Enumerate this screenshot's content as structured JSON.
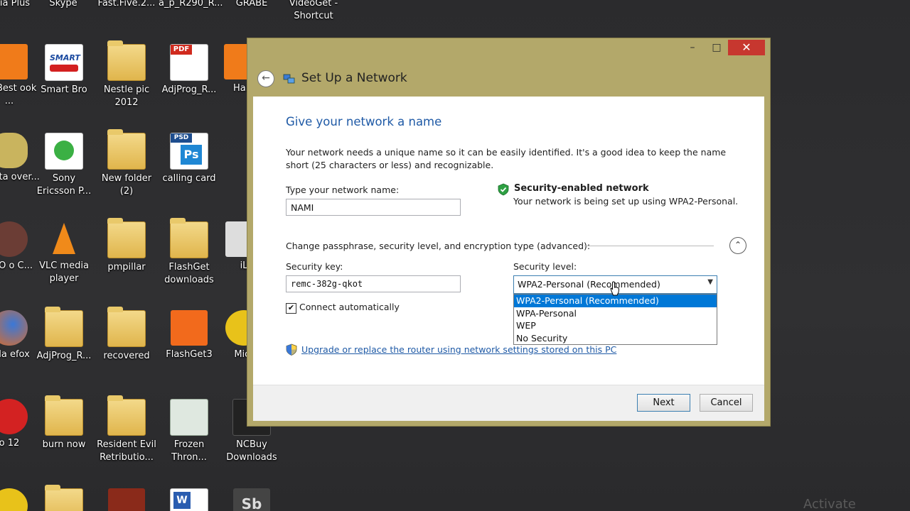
{
  "desktop": {
    "icons": [
      {
        "label": "ia Plus"
      },
      {
        "label": "Skype"
      },
      {
        "label": "Fast.Five.2..."
      },
      {
        "label": "a_p_R290_R..."
      },
      {
        "label": "GRABE"
      },
      {
        "label": "VideoGet - Shortcut"
      },
      {
        "label": "he Best ook ..."
      },
      {
        "label": "Smart Bro"
      },
      {
        "label": "Nestle pic 2012"
      },
      {
        "label": "AdjProg_R..."
      },
      {
        "label": "Han"
      },
      {
        "label": "e data over..."
      },
      {
        "label": "Sony Ericsson P..."
      },
      {
        "label": "New folder (2)"
      },
      {
        "label": "calling card"
      },
      {
        "label": "TOO o C..."
      },
      {
        "label": "VLC media player"
      },
      {
        "label": "pmpillar"
      },
      {
        "label": "FlashGet downloads"
      },
      {
        "label": "iL"
      },
      {
        "label": "zilla efox"
      },
      {
        "label": "AdjProg_R..."
      },
      {
        "label": "recovered"
      },
      {
        "label": "FlashGet3"
      },
      {
        "label": "Micr"
      },
      {
        "label": "o 12"
      },
      {
        "label": "burn now"
      },
      {
        "label": "Resident Evil Retributio..."
      },
      {
        "label": "Frozen Thron..."
      },
      {
        "label": "NCBuy Downloads"
      }
    ],
    "badge_texts": {
      "smart": "SMART",
      "pdf": "PDF",
      "psd": "PSD",
      "ps": "Ps",
      "sb": "Sb",
      "w": "W"
    },
    "watermark": "Activate"
  },
  "dialog": {
    "title": "Set Up a Network",
    "window_buttons": {
      "minimize": "–",
      "maximize": "□",
      "close": "✕"
    },
    "back_icon": "←",
    "heading": "Give your network a name",
    "intro": "Your network needs a unique name so it can be easily identified. It's a good idea to keep the name short (25 characters or less) and recognizable.",
    "network_name_label": "Type your network name:",
    "network_name_value": "NAMI",
    "security_note_title": "Security-enabled network",
    "security_note_desc": "Your network is being set up using WPA2-Personal.",
    "advanced_label": "Change passphrase, security level, and encryption type (advanced):",
    "collapse_icon": "⌃",
    "security_key_label": "Security key:",
    "security_key_value": "remc-382g-qkot",
    "security_level_label": "Security level:",
    "security_level_selected": "WPA2-Personal (Recommended)",
    "dropdown_arrow": "▼",
    "security_level_options": [
      "WPA2-Personal (Recommended)",
      "WPA-Personal",
      "WEP",
      "No Security"
    ],
    "connect_auto_checked": "✔",
    "connect_auto_label": "Connect automatically",
    "upgrade_link": "Upgrade or replace the router using network settings stored on this PC",
    "next_button": "Next",
    "cancel_button": "Cancel"
  },
  "colors": {
    "accent": "#1f5aa6",
    "titlebar": "#b3a86a",
    "close": "#c7372f",
    "highlight": "#0078d7"
  }
}
